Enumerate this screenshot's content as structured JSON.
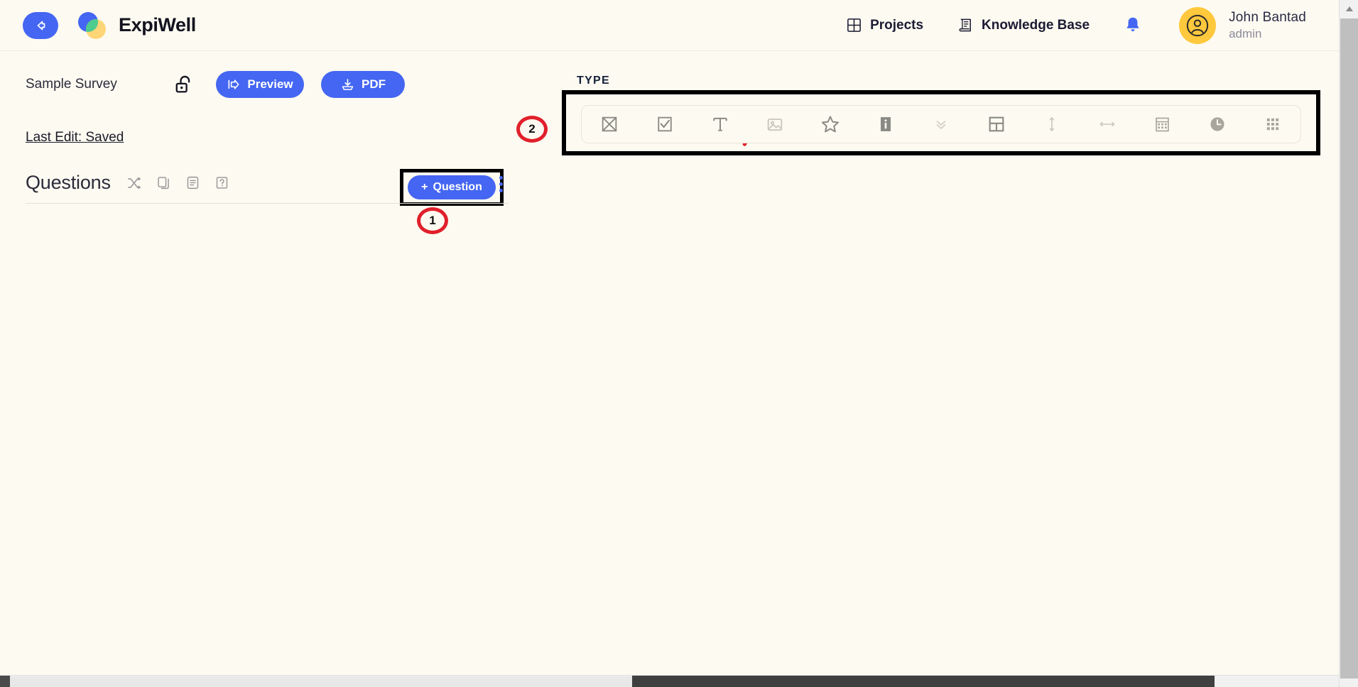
{
  "app": {
    "brand_name": "ExpiWell",
    "background_color": "#FDFAF1",
    "accent_color": "#4466F2",
    "annotation_color": "#E0202B",
    "avatar_color": "#FFC83D"
  },
  "header": {
    "back_label": "Back",
    "nav": [
      {
        "label": "Projects",
        "icon": "grid-icon"
      },
      {
        "label": "Knowledge Base",
        "icon": "book-icon"
      }
    ],
    "notifications_icon": "bell-icon",
    "user": {
      "name": "John Bantad",
      "role": "admin",
      "avatar_icon": "user-avatar-icon"
    }
  },
  "survey": {
    "title": "Sample Survey",
    "lock_icon": "unlock-icon",
    "preview_label": "Preview",
    "preview_icon": "preview-arrow-icon",
    "pdf_label": "PDF",
    "pdf_icon": "download-icon",
    "last_edit": "Last Edit: Saved"
  },
  "questions": {
    "heading": "Questions",
    "tools": [
      {
        "name": "shuffle-icon"
      },
      {
        "name": "duplicate-icon"
      },
      {
        "name": "notes-icon"
      },
      {
        "name": "help-icon"
      }
    ],
    "add_label": "Question",
    "add_prefix": "+",
    "kebab_icon": "more-vertical-icon"
  },
  "type_panel": {
    "label": "TYPE",
    "items": [
      {
        "name": "multiple-choice-icon",
        "title": "Multiple Choice"
      },
      {
        "name": "checkbox-icon",
        "title": "Checkbox"
      },
      {
        "name": "text-icon",
        "title": "Text"
      },
      {
        "name": "image-icon",
        "title": "Image"
      },
      {
        "name": "star-rating-icon",
        "title": "Star Rating"
      },
      {
        "name": "info-icon",
        "title": "Info"
      },
      {
        "name": "dropdown-icon",
        "title": "Dropdown"
      },
      {
        "name": "layout-icon",
        "title": "Layout"
      },
      {
        "name": "vertical-slider-icon",
        "title": "Vertical Slider"
      },
      {
        "name": "horizontal-slider-icon",
        "title": "Horizontal Slider"
      },
      {
        "name": "calendar-icon",
        "title": "Date"
      },
      {
        "name": "clock-icon",
        "title": "Time"
      },
      {
        "name": "matrix-icon",
        "title": "Matrix"
      }
    ]
  },
  "annotations": [
    {
      "id": "1",
      "label": "1",
      "target": "add-question-button"
    },
    {
      "id": "2",
      "label": "2",
      "target": "type-toolbar"
    }
  ],
  "scrollbars": {
    "vertical_arrow": "scroll-up-arrow",
    "horizontal": "horizontal-scrollbar"
  }
}
